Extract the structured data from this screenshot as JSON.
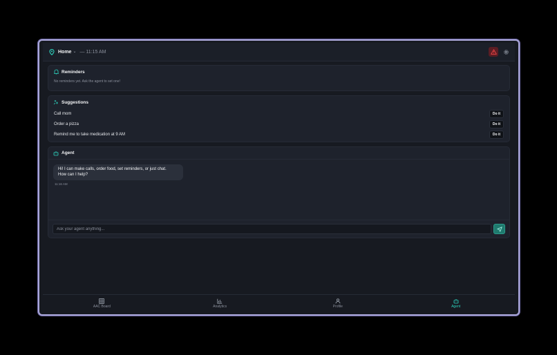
{
  "header": {
    "location_label": "Home",
    "time_text": "— 11:15 AM",
    "icons": {
      "location": "map-pin-icon",
      "alert": "alert-triangle-icon",
      "settings": "gear-icon"
    }
  },
  "reminders": {
    "title": "Reminders",
    "empty_text": "No reminders yet. Ask the agent to set one!"
  },
  "suggestions": {
    "title": "Suggestions",
    "items": [
      {
        "text": "Call mom",
        "action": "Do it"
      },
      {
        "text": "Order a pizza",
        "action": "Do it"
      },
      {
        "text": "Remind me to take medication at 9 AM",
        "action": "Do it"
      }
    ]
  },
  "agent": {
    "title": "Agent",
    "messages": [
      {
        "line1": "Hi! I can make calls, order food, set reminders, or just chat.",
        "line2": "How can I help?",
        "time": "11:16 AM"
      }
    ],
    "input_placeholder": "Ask your agent anything..."
  },
  "nav": {
    "items": [
      {
        "label": "AAC Board",
        "icon": "grid-icon"
      },
      {
        "label": "Analytics",
        "icon": "bar-chart-icon"
      },
      {
        "label": "Profile",
        "icon": "user-icon"
      },
      {
        "label": "Agent",
        "icon": "bot-icon",
        "active": true
      }
    ]
  },
  "colors": {
    "accent": "#2dd4bf",
    "background": "#171a21",
    "card": "#1e222c",
    "alert": "#ef4444"
  }
}
